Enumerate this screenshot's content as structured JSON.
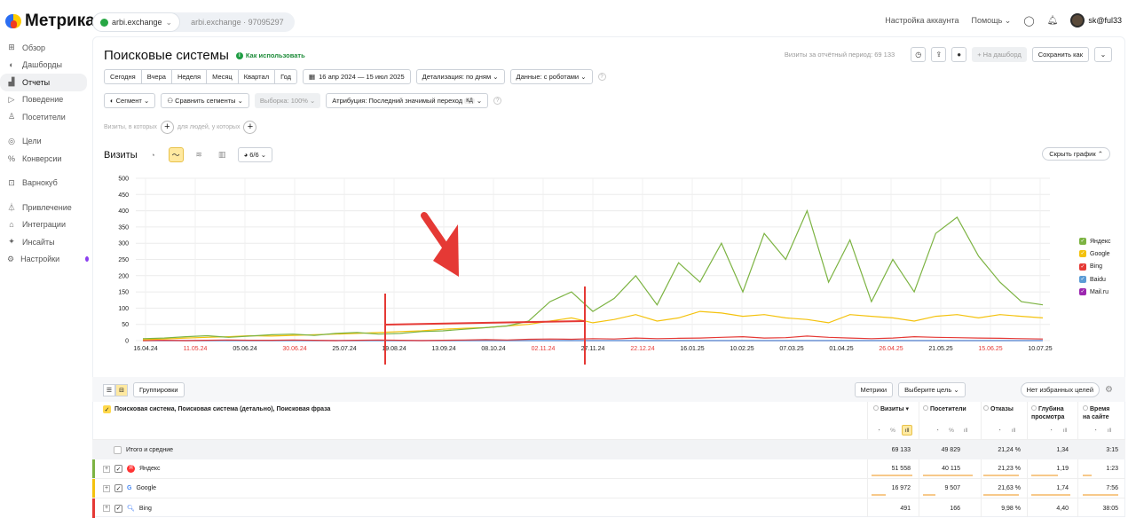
{
  "app": {
    "logo_text": "Метрика"
  },
  "counter": {
    "site": "arbi.exchange",
    "site_id": "arbi.exchange · 97095297"
  },
  "topnav": {
    "account_settings": "Настройка аккаунта",
    "help": "Помощь",
    "user": "sk@ful33"
  },
  "sidebar": {
    "items": [
      {
        "label": "Обзор",
        "icon": "grid-icon"
      },
      {
        "label": "Дашборды",
        "icon": "dashboard-icon"
      },
      {
        "label": "Отчеты",
        "icon": "reports-icon",
        "active": true
      },
      {
        "label": "Поведение",
        "icon": "play-icon"
      },
      {
        "label": "Посетители",
        "icon": "user-icon"
      },
      {
        "label": "Цели",
        "icon": "target-icon"
      },
      {
        "label": "Конверсии",
        "icon": "percent-icon"
      },
      {
        "label": "Варнокуб",
        "icon": "cube-icon"
      },
      {
        "label": "Привлечение",
        "icon": "funnel-icon"
      },
      {
        "label": "Интеграции",
        "icon": "plug-icon"
      },
      {
        "label": "Инсайты",
        "icon": "sparkle-icon"
      },
      {
        "label": "Настройки",
        "icon": "gear-icon"
      }
    ]
  },
  "report": {
    "title": "Поисковые системы",
    "how_to_use": "Как использовать",
    "visits_period": "Визиты за отчётный период: 69 133",
    "to_dashboard": "На дашборд",
    "save_as": "Сохранить как",
    "periods": [
      "Сегодня",
      "Вчера",
      "Неделя",
      "Месяц",
      "Квартал",
      "Год"
    ],
    "date_range": "16 апр 2024 — 15 июл 2025",
    "detail": "Детализация: по дням",
    "data_mode": "Данные: с роботами",
    "segment": "Сегмент",
    "compare": "Сравнить сегменты",
    "sample": "Выборка: 100%",
    "attribution": "Атрибуция: Последний значимый переход",
    "attribution_badge": "КД",
    "visits_where": "Визиты, в которых",
    "people_who": "для людей, у которых",
    "chart_label": "Визиты",
    "series_count": "6/6",
    "hide_chart": "Скрыть график"
  },
  "chart_data": {
    "type": "line",
    "ylim": [
      0,
      500
    ],
    "yticks": [
      0,
      50,
      100,
      150,
      200,
      250,
      300,
      350,
      400,
      450,
      500
    ],
    "xticks": [
      "16.04.24",
      "11.05.24",
      "05.06.24",
      "30.06.24",
      "25.07.24",
      "19.08.24",
      "13.09.24",
      "08.10.24",
      "02.11.24",
      "27.11.24",
      "22.12.24",
      "16.01.25",
      "10.02.25",
      "07.03.25",
      "01.04.25",
      "26.04.25",
      "21.05.25",
      "15.06.25",
      "10.07.25"
    ],
    "red_ticks": [
      "11.05.24",
      "30.06.24",
      "02.11.24",
      "22.12.24",
      "26.04.25",
      "15.06.25"
    ],
    "series": [
      {
        "name": "Яндекс",
        "color": "#7cb342",
        "values": [
          6,
          8,
          12,
          15,
          10,
          14,
          18,
          20,
          16,
          22,
          25,
          20,
          22,
          28,
          30,
          35,
          40,
          45,
          60,
          120,
          150,
          90,
          130,
          200,
          110,
          240,
          180,
          300,
          150,
          330,
          250,
          400,
          180,
          310,
          120,
          250,
          150,
          330,
          380,
          260,
          180,
          120,
          110
        ]
      },
      {
        "name": "Google",
        "color": "#f4c20d",
        "values": [
          3,
          5,
          8,
          10,
          12,
          15,
          14,
          16,
          18,
          20,
          22,
          25,
          28,
          30,
          35,
          38,
          40,
          45,
          50,
          60,
          70,
          55,
          65,
          80,
          60,
          70,
          90,
          85,
          75,
          80,
          70,
          65,
          55,
          80,
          75,
          70,
          60,
          75,
          80,
          70,
          80,
          75,
          70
        ]
      },
      {
        "name": "Bing",
        "color": "#e53935",
        "values": [
          0,
          1,
          0,
          1,
          2,
          1,
          1,
          2,
          1,
          0,
          1,
          2,
          1,
          0,
          1,
          2,
          3,
          2,
          4,
          5,
          4,
          6,
          5,
          8,
          6,
          7,
          8,
          10,
          12,
          8,
          9,
          14,
          10,
          8,
          6,
          8,
          12,
          10,
          9,
          8,
          7,
          6,
          5
        ]
      },
      {
        "name": "Baidu",
        "color": "#5b9bd5",
        "values": [
          0,
          0,
          0,
          0,
          0,
          0,
          0,
          0,
          0,
          0,
          0,
          0,
          0,
          0,
          0,
          0,
          0,
          0,
          0,
          0,
          0,
          0,
          0,
          0,
          0,
          0,
          0,
          0,
          0,
          0,
          0,
          0,
          0,
          0,
          0,
          0,
          0,
          0,
          0,
          0,
          0,
          0,
          0
        ]
      },
      {
        "name": "Mail.ru",
        "color": "#9c27b0",
        "values": [
          0,
          0,
          0,
          0,
          0,
          0,
          0,
          0,
          0,
          0,
          0,
          0,
          0,
          0,
          0,
          0,
          0,
          0,
          0,
          0,
          0,
          0,
          0,
          0,
          0,
          0,
          0,
          0,
          0,
          0,
          0,
          0,
          0,
          0,
          0,
          0,
          0,
          0,
          0,
          0,
          0,
          0,
          0
        ]
      }
    ]
  },
  "table": {
    "view_modes": [
      "list-icon",
      "tree-icon"
    ],
    "groupings": "Группировки",
    "metrics": "Метрики",
    "choose_goal": "Выберите цель",
    "no_fav_goals": "Нет избранных целей",
    "dimension_title": "Поисковая система, Поисковая система (детально), Поисковая фраза",
    "columns": [
      {
        "label": "Визиты ▾"
      },
      {
        "label": "Посетители"
      },
      {
        "label": "Отказы"
      },
      {
        "label": "Глубина просмотра"
      },
      {
        "label": "Время на сайте"
      }
    ],
    "rows": [
      {
        "name": "Итого и средние",
        "values": [
          "69 133",
          "49 829",
          "21,24 %",
          "1,34",
          "3:15"
        ]
      },
      {
        "name": "Яндекс",
        "values": [
          "51 558",
          "40 115",
          "21,23 %",
          "1,19",
          "1:23"
        ],
        "color": "#7cb342"
      },
      {
        "name": "Google",
        "values": [
          "16 972",
          "9 507",
          "21,63 %",
          "1,74",
          "7:56"
        ],
        "color": "#f4c20d"
      },
      {
        "name": "Bing",
        "values": [
          "491",
          "166",
          "9,98 %",
          "4,40",
          "38:05"
        ],
        "color": "#e53935"
      }
    ]
  }
}
